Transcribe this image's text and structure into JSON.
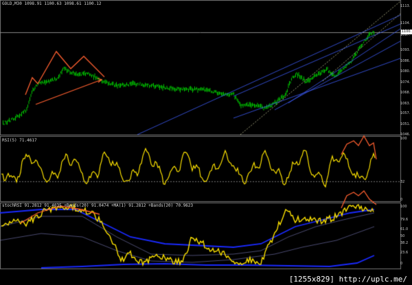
{
  "header": {
    "main": "GOLD,M30  1098.91 1100.63 1098.61 1100.12"
  },
  "rsi": {
    "label": "RSI(5) 71.4617"
  },
  "stoch": {
    "label": "stochRSI 91.2812  91.4035  +Bands(20) 91.0474  +MA(1) 91.2812  +Bands(20) 70.9623"
  },
  "main_axis": [
    "1113.",
    "1104.",
    "1097.",
    "1093.",
    "1086.",
    "1080.",
    "1074.",
    "1068.",
    "1063.",
    "1057.",
    "1051.",
    "1046."
  ],
  "price_tag": "1100.",
  "rsi_axis": [
    "100",
    "32",
    "0"
  ],
  "stoch_axis": [
    "100",
    "79.6",
    "61.0",
    "50",
    "38.2",
    "23.6",
    "0"
  ],
  "watermark": "[1255x829] http://uplc.me/",
  "colors": {
    "price": "#00c800",
    "osc": "#ffe400",
    "annot": "#ff6030",
    "channel": "#4060ff",
    "trend": "#cfcfa0",
    "band": "#1a2aff"
  }
}
